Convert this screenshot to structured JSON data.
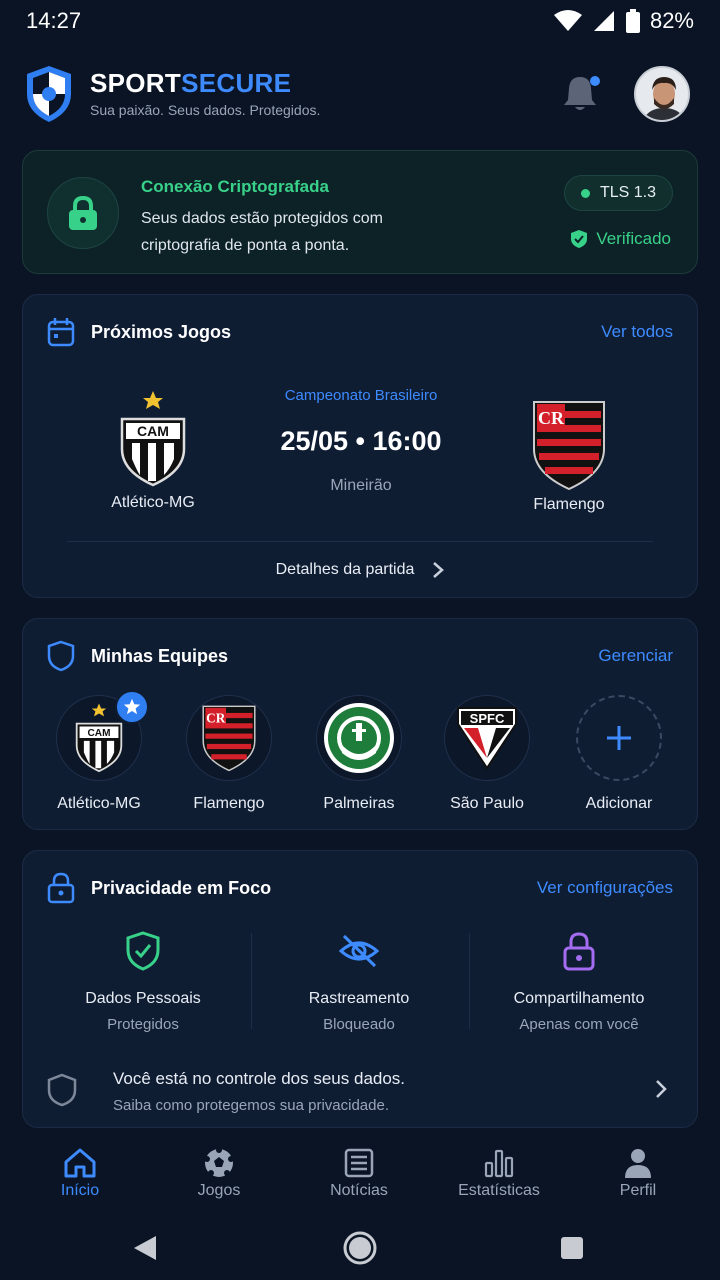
{
  "status": {
    "time": "14:27",
    "battery": "82%"
  },
  "header": {
    "brand_a": "SPORT",
    "brand_b": "SECURE",
    "tagline": "Sua paixão. Seus dados. Protegidos."
  },
  "secure": {
    "title": "Conexão Criptografada",
    "desc": "Seus dados estão protegidos com criptografia de ponta a ponta.",
    "tls": "TLS 1.3",
    "verified": "Verificado"
  },
  "games": {
    "title": "Próximos Jogos",
    "link": "Ver todos",
    "competition": "Campeonato Brasileiro",
    "datetime": "25/05 • 16:00",
    "venue": "Mineirão",
    "home": "Atlético-MG",
    "away": "Flamengo",
    "details": "Detalhes da partida"
  },
  "teams": {
    "title": "Minhas Equipes",
    "link": "Gerenciar",
    "items": [
      {
        "label": "Atlético-MG"
      },
      {
        "label": "Flamengo"
      },
      {
        "label": "Palmeiras"
      },
      {
        "label": "São Paulo"
      },
      {
        "label": "Adicionar"
      }
    ]
  },
  "privacy": {
    "title": "Privacidade em Foco",
    "link": "Ver configurações",
    "cols": [
      {
        "t1": "Dados Pessoais",
        "t2": "Protegidos"
      },
      {
        "t1": "Rastreamento",
        "t2": "Bloqueado"
      },
      {
        "t1": "Compartilhamento",
        "t2": "Apenas com você"
      }
    ],
    "foot_t1": "Você está no controle dos seus dados.",
    "foot_t2": "Saiba como protegemos sua privacidade."
  },
  "nav": {
    "items": [
      {
        "label": "Início"
      },
      {
        "label": "Jogos"
      },
      {
        "label": "Notícias"
      },
      {
        "label": "Estatísticas"
      },
      {
        "label": "Perfil"
      }
    ]
  },
  "colors": {
    "accent": "#3d8bff",
    "success": "#38d18a",
    "background": "#0a1424",
    "card": "#0f1d33",
    "purple": "#a46cf0"
  },
  "icons": [
    "shield-logo-icon",
    "bell-icon",
    "lock-icon",
    "check-shield-icon",
    "calendar-icon",
    "chevron-right-icon",
    "shield-outline-icon",
    "star-icon",
    "plus-icon",
    "eye-off-icon",
    "home-icon",
    "soccer-ball-icon",
    "newspaper-icon",
    "bar-chart-icon",
    "person-icon"
  ]
}
